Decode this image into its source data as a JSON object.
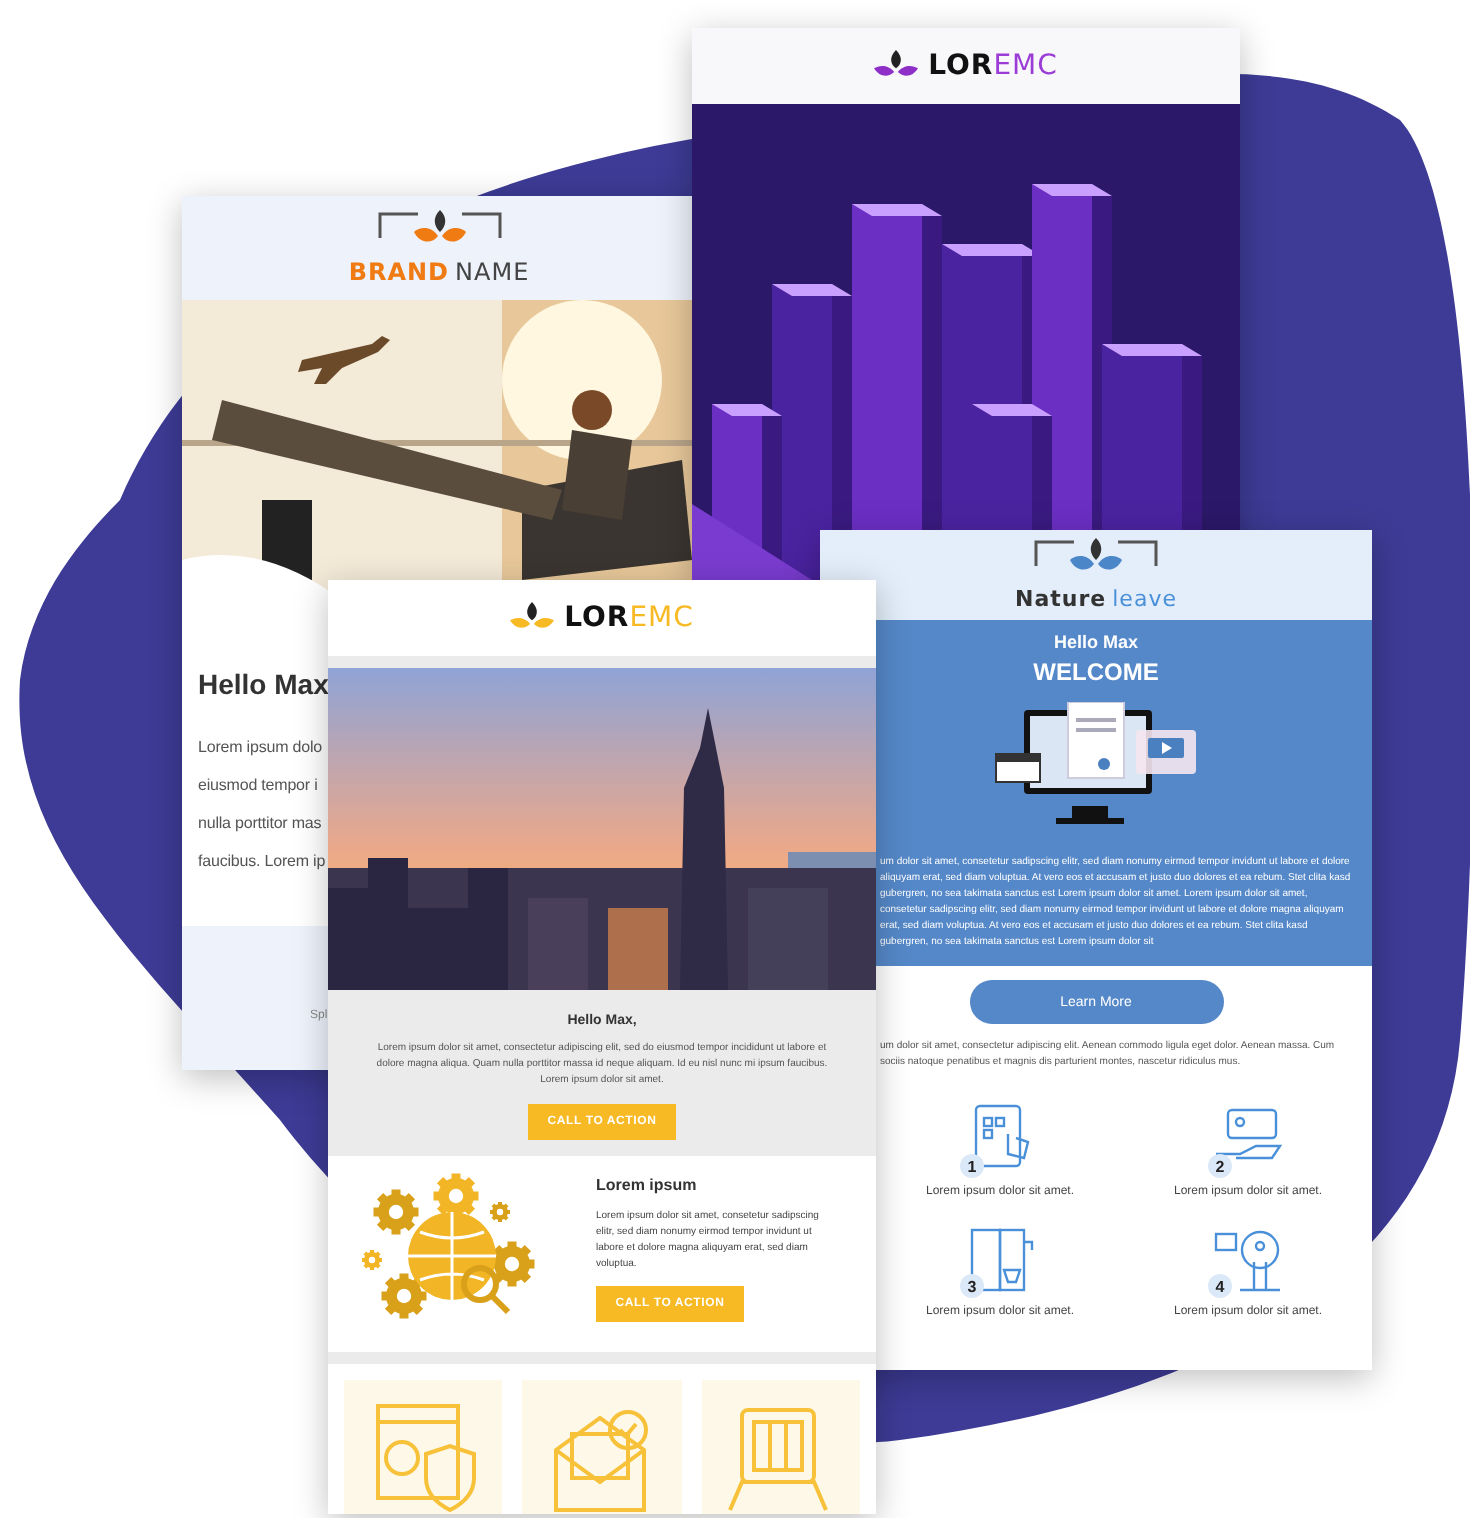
{
  "brand_email": {
    "logo": {
      "strong": "BRAND",
      "light": "NAME"
    },
    "greeting": "Hello Max",
    "body_lines": [
      "Lorem ipsum dolo",
      "eiusmod tempor i",
      "nulla porttitor mas",
      "faucibus. Lorem ip"
    ],
    "footer": "Spl"
  },
  "purple_email": {
    "logo": {
      "strong": "LOR",
      "light": "EMC"
    }
  },
  "nature_email": {
    "logo": {
      "strong": "Nature",
      "light": "leave"
    },
    "greeting": "Hello Max",
    "headline": "WELCOME",
    "intro": "um dolor sit amet, consetetur sadipscing elitr, sed diam nonumy eirmod tempor invidunt ut labore et dolore aliquyam erat, sed diam voluptua. At vero eos et accusam et justo duo dolores et ea rebum. Stet clita kasd gubergren, no sea takimata sanctus est Lorem ipsum dolor sit amet. Lorem ipsum dolor sit amet, consetetur sadipscing elitr, sed diam nonumy eirmod tempor invidunt ut labore et dolore magna aliquyam erat, sed diam voluptua. At vero eos et accusam et justo duo dolores et ea rebum. Stet clita kasd gubergren, no sea takimata sanctus est Lorem ipsum dolor sit",
    "button": "Learn More",
    "body": "um dolor sit amet, consectetur adipiscing elit. Aenean commodo ligula eget dolor. Aenean massa. Cum sociis natoque penatibus et magnis dis parturient montes, nascetur ridiculus mus.",
    "features": [
      {
        "kind": "touchscreen",
        "number": "1",
        "label": "Lorem ipsum dolor sit amet."
      },
      {
        "kind": "card-in-hand",
        "number": "2",
        "label": "Lorem ipsum dolor sit amet."
      },
      {
        "kind": "machine",
        "number": "3",
        "label": "Lorem ipsum dolor sit amet."
      },
      {
        "kind": "kiosk",
        "number": "4",
        "label": "Lorem ipsum dolor sit amet."
      }
    ]
  },
  "yellow_email": {
    "logo": {
      "strong": "LOR",
      "light": "EMC"
    },
    "greeting": "Hello Max,",
    "intro": "Lorem ipsum dolor sit amet, consectetur adipiscing elit, sed do eiusmod tempor incididunt ut labore et dolore magna aliqua. Quam nulla porttitor massa id neque aliquam. Id eu nisl nunc mi ipsum faucibus. Lorem ipsum dolor sit amet.",
    "button": "CALL TO ACTION",
    "section_title": "Lorem ipsum",
    "section_text": "Lorem ipsum dolor sit amet, consetetur sadipscing elitr, sed diam nonumy eirmod tempor invidunt ut labore et dolore magna aliquyam erat, sed diam voluptua.",
    "section_button": "CALL TO ACTION",
    "tiles": [
      {
        "kind": "security"
      },
      {
        "kind": "mail"
      },
      {
        "kind": "card-reader"
      }
    ]
  }
}
